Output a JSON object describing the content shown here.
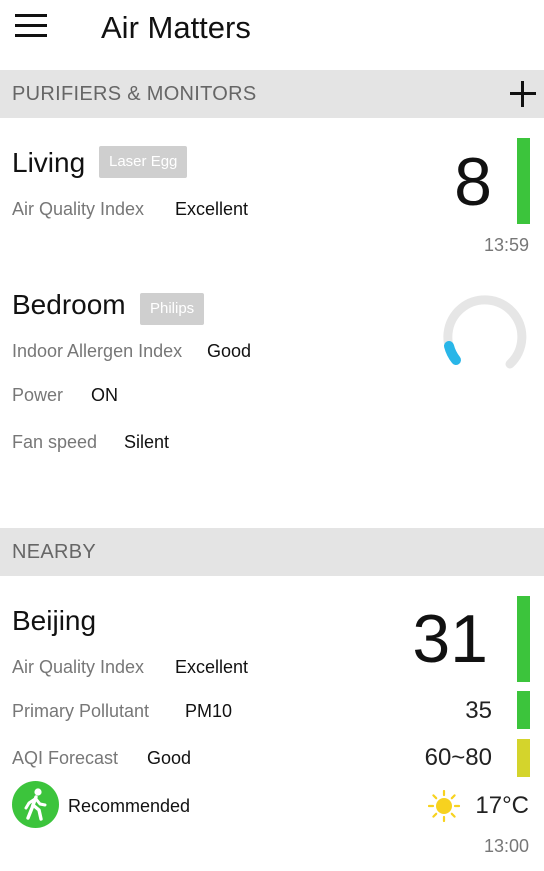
{
  "app": {
    "title": "Air Matters"
  },
  "sections": {
    "devices_header": "PURIFIERS & MONITORS",
    "nearby_header": "NEARBY"
  },
  "living": {
    "name": "Living",
    "device_chip": "Laser Egg",
    "aqi_label": "Air Quality Index",
    "aqi_status": "Excellent",
    "aqi_value": "8",
    "time": "13:59",
    "bar_color": "#3cc43c"
  },
  "bedroom": {
    "name": "Bedroom",
    "device_chip": "Philips",
    "allergen_label": "Indoor Allergen Index",
    "allergen_status": "Good",
    "power_label": "Power",
    "power_value": "ON",
    "fan_label": "Fan speed",
    "fan_value": "Silent",
    "gauge_level": 0.12,
    "gauge_color": "#29b6e8",
    "gauge_track_color": "#e6e6e6"
  },
  "beijing": {
    "name": "Beijing",
    "aqi_label": "Air Quality Index",
    "aqi_status": "Excellent",
    "aqi_value": "31",
    "pollutant_label": "Primary Pollutant",
    "pollutant_value": "PM10",
    "pollutant_number": "35",
    "forecast_label": "AQI Forecast",
    "forecast_status": "Good",
    "forecast_range": "60~80",
    "recommendation": "Recommended",
    "temperature": "17°C",
    "time": "13:00",
    "bar_colors": {
      "aqi": "#3cc43c",
      "pollutant": "#3cc43c",
      "forecast": "#d4d42c"
    },
    "icons": {
      "activity": "walking-person-icon",
      "weather": "sun-icon"
    }
  }
}
